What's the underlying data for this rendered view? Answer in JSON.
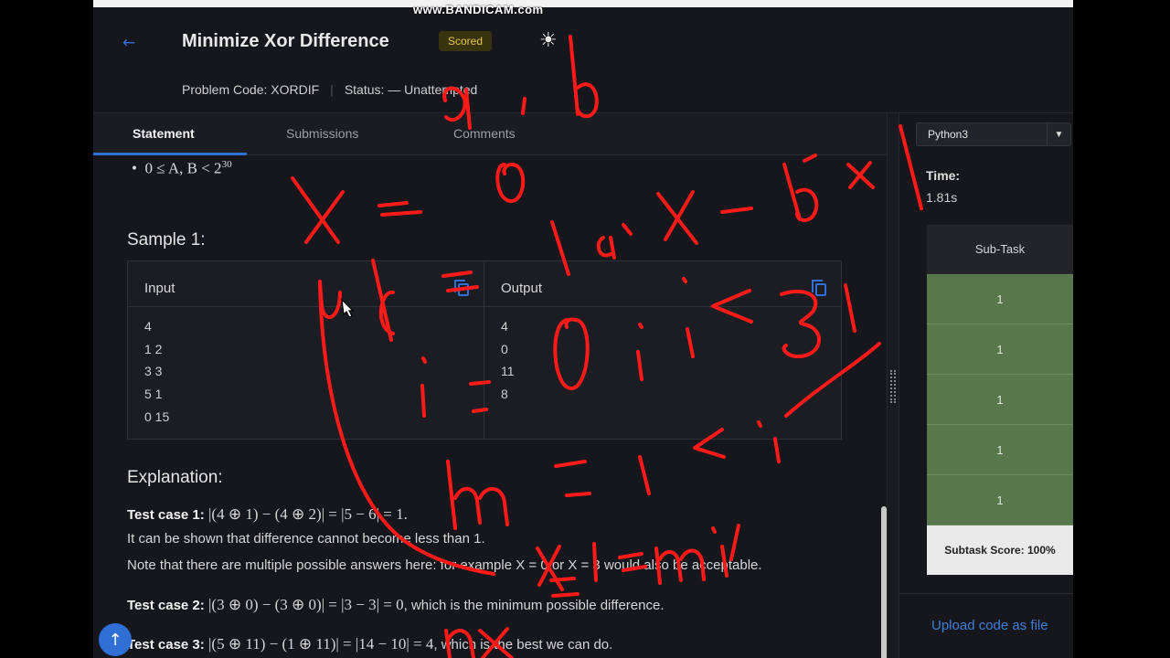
{
  "watermark": "www.BANDICAM.com",
  "header": {
    "title": "Minimize Xor Difference",
    "badge": "Scored",
    "problem_code": "Problem Code: XORDIF",
    "status": "Status: — Unattempted"
  },
  "tabs": [
    {
      "label": "Statement"
    },
    {
      "label": "Submissions"
    },
    {
      "label": "Comments"
    }
  ],
  "statement": {
    "constraint": "0 ≤ A, B < 2",
    "constraint_exp": "30",
    "sample_title": "Sample 1:",
    "input_label": "Input",
    "output_label": "Output",
    "input_lines": [
      "4",
      "1 2",
      "3 3",
      "5 1",
      "0 15"
    ],
    "output_lines": [
      "4",
      "0",
      "11",
      "8"
    ],
    "explanation_title": "Explanation:",
    "tc1_label": "Test case 1:",
    "tc1_math": " |(4 ⊕ 1) − (4 ⊕ 2)| = |5 − 6| = 1.",
    "line2": "It can be shown that difference cannot become less than 1.",
    "line3": "Note that there are multiple possible answers here: for example X = 0 or X = 3 would also be acceptable.",
    "tc2_label": "Test case 2:",
    "tc2_math": " |(3 ⊕ 0) − (3 ⊕ 0)| = |3 − 3| = 0",
    "tc2_rest": ", which is the minimum possible difference.",
    "tc3_label": "Test case 3:",
    "tc3_math": " |(5 ⊕ 11) − (1 ⊕ 11)| = |14 − 10| = 4",
    "tc3_rest": ", which is the best we can do."
  },
  "right_panel": {
    "language": "Python3",
    "time_label": "Time:",
    "time_value": "1.81s",
    "subtask_header": "Sub-Task",
    "subtasks": [
      "1",
      "1",
      "1",
      "1",
      "1"
    ],
    "subtask_score": "Subtask Score: 100%",
    "upload": "Upload code as file"
  },
  "colors": {
    "accent": "#2f6fd6",
    "scored_badge": "#e6c64a",
    "subtask_pass": "#56784a",
    "annotation": "#ff0000"
  }
}
